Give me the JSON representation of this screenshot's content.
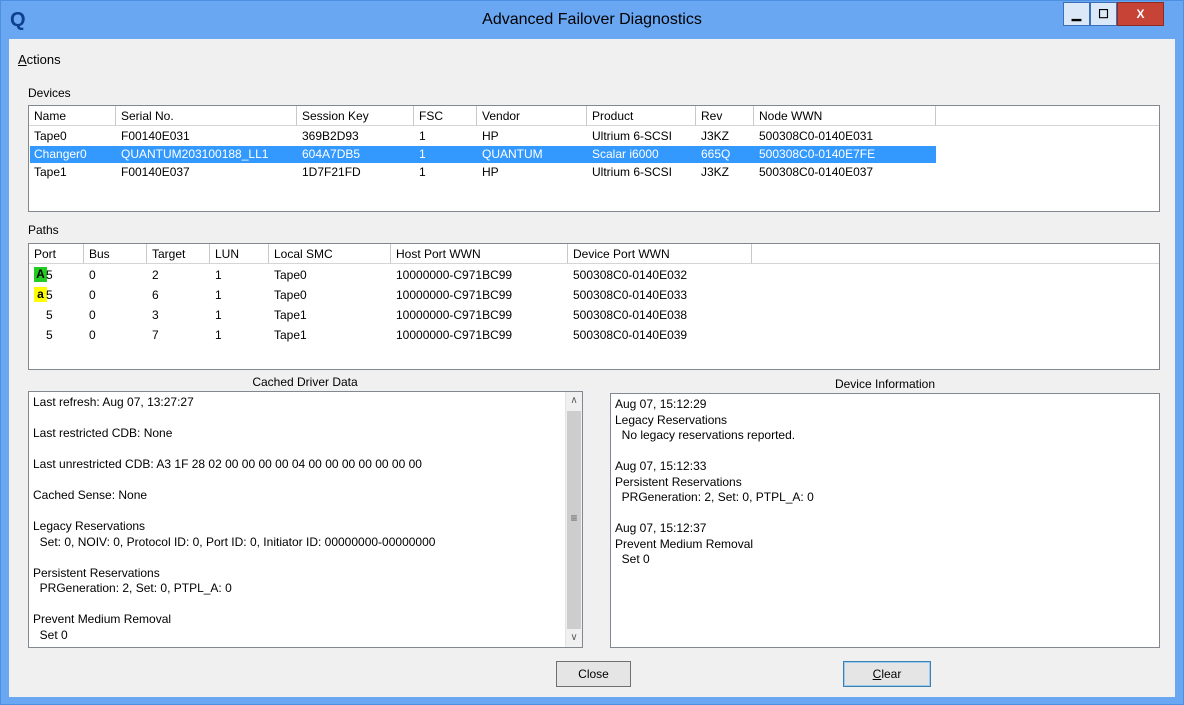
{
  "window": {
    "title": "Advanced Failover Diagnostics",
    "icon_glyph": "Q",
    "min_glyph": "▁",
    "max_glyph": "☐",
    "close_glyph": "X"
  },
  "menu": {
    "actions_first": "A",
    "actions_rest": "ctions"
  },
  "devices": {
    "label": "Devices",
    "columns": [
      "Name",
      "Serial No.",
      "Session Key",
      "FSC",
      "Vendor",
      "Product",
      "Rev",
      "Node WWN"
    ],
    "rows": [
      [
        "Tape0",
        "F00140E031",
        "369B2D93",
        "1",
        "HP",
        "Ultrium 6-SCSI",
        "J3KZ",
        "500308C0-0140E031"
      ],
      [
        "Changer0",
        "QUANTUM203100188_LL1",
        "604A7DB5",
        "1",
        "QUANTUM",
        "Scalar i6000",
        "665Q",
        "500308C0-0140E7FE"
      ],
      [
        "Tape1",
        "F00140E037",
        "1D7F21FD",
        "1",
        "HP",
        "Ultrium 6-SCSI",
        "J3KZ",
        "500308C0-0140E037"
      ]
    ],
    "selected_row": 1
  },
  "paths": {
    "label": "Paths",
    "columns": [
      "Port",
      "Bus",
      "Target",
      "LUN",
      "Local SMC",
      "Host Port WWN",
      "Device Port WWN"
    ],
    "rows": [
      {
        "badge": "A",
        "badge_color": "#22cc22",
        "cells": [
          "5",
          "0",
          "2",
          "1",
          "Tape0",
          "10000000-C971BC99",
          "500308C0-0140E032"
        ]
      },
      {
        "badge": "a",
        "badge_color": "#ffff00",
        "cells": [
          "5",
          "0",
          "6",
          "1",
          "Tape0",
          "10000000-C971BC99",
          "500308C0-0140E033"
        ]
      },
      {
        "badge": "",
        "badge_color": "",
        "cells": [
          "5",
          "0",
          "3",
          "1",
          "Tape1",
          "10000000-C971BC99",
          "500308C0-0140E038"
        ]
      },
      {
        "badge": "",
        "badge_color": "",
        "cells": [
          "5",
          "0",
          "7",
          "1",
          "Tape1",
          "10000000-C971BC99",
          "500308C0-0140E039"
        ]
      }
    ]
  },
  "cached": {
    "label": "Cached Driver Data",
    "lines": [
      "Last refresh: Aug 07, 13:27:27",
      "",
      "Last restricted CDB: None",
      "",
      "Last unrestricted CDB: A3 1F 28 02 00 00 00 00 04 00 00 00 00 00 00 00",
      "",
      "Cached Sense: None",
      "",
      "Legacy Reservations",
      "  Set: 0, NOIV: 0, Protocol ID: 0, Port ID: 0, Initiator ID: 00000000-00000000",
      "",
      "Persistent Reservations",
      "  PRGeneration: 2, Set: 0, PTPL_A: 0",
      "",
      "Prevent Medium Removal",
      "  Set 0"
    ],
    "scroll_up": "∧",
    "scroll_down": "∨",
    "scroll_grip": "≡"
  },
  "device_info": {
    "label": "Device Information",
    "lines": [
      "Aug 07, 15:12:29",
      "Legacy Reservations",
      "  No legacy reservations reported.",
      "",
      "Aug 07, 15:12:33",
      "Persistent Reservations",
      "  PRGeneration: 2, Set: 0, PTPL_A: 0",
      "",
      "Aug 07, 15:12:37",
      "Prevent Medium Removal",
      "  Set 0"
    ]
  },
  "buttons": {
    "close": "Close",
    "clear_first": "C",
    "clear_rest": "lear"
  },
  "colors": {
    "title_bar": "#6aa7f2",
    "selection": "#3399ff",
    "close_button": "#c74336"
  }
}
